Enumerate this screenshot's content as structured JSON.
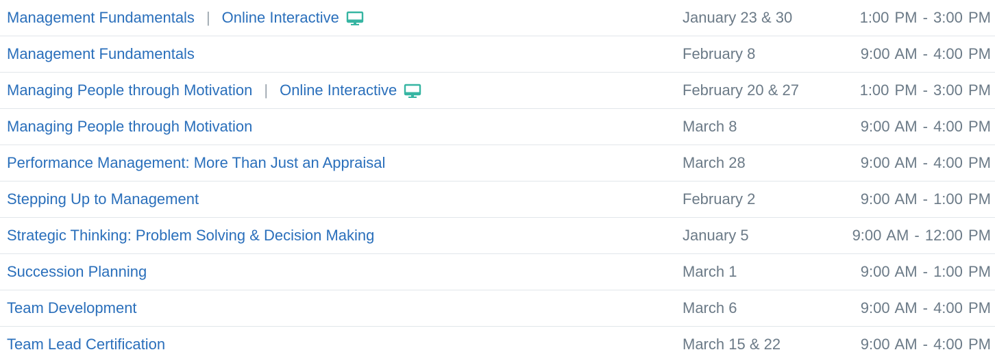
{
  "separator": "|",
  "accent_color": "#2a6fbb",
  "icon_color": "#36b5a2",
  "rows": [
    {
      "course": "Management Fundamentals",
      "mode": "Online Interactive",
      "icon": "monitor-icon",
      "date": "January 23 & 30",
      "time": "1:00 PM - 3:00 PM"
    },
    {
      "course": "Management Fundamentals",
      "mode": "",
      "icon": "",
      "date": "February 8",
      "time": "9:00 AM - 4:00 PM"
    },
    {
      "course": "Managing People through Motivation",
      "mode": "Online Interactive",
      "icon": "monitor-icon",
      "date": "February 20 & 27",
      "time": "1:00 PM - 3:00 PM"
    },
    {
      "course": "Managing People through Motivation",
      "mode": "",
      "icon": "",
      "date": "March 8",
      "time": "9:00 AM - 4:00 PM"
    },
    {
      "course": "Performance Management: More Than Just an Appraisal",
      "mode": "",
      "icon": "",
      "date": "March 28",
      "time": "9:00 AM - 4:00 PM"
    },
    {
      "course": "Stepping Up to Management",
      "mode": "",
      "icon": "",
      "date": "February 2",
      "time": "9:00 AM - 1:00 PM"
    },
    {
      "course": "Strategic Thinking: Problem Solving & Decision Making",
      "mode": "",
      "icon": "",
      "date": "January 5",
      "time": "9:00 AM - 12:00 PM"
    },
    {
      "course": "Succession Planning",
      "mode": "",
      "icon": "",
      "date": "March 1",
      "time": "9:00 AM - 1:00 PM"
    },
    {
      "course": "Team Development",
      "mode": "",
      "icon": "",
      "date": "March 6",
      "time": "9:00 AM - 4:00 PM"
    },
    {
      "course": "Team Lead Certification",
      "mode": "",
      "icon": "",
      "date": "March 15 & 22",
      "time": "9:00 AM - 4:00 PM"
    }
  ]
}
